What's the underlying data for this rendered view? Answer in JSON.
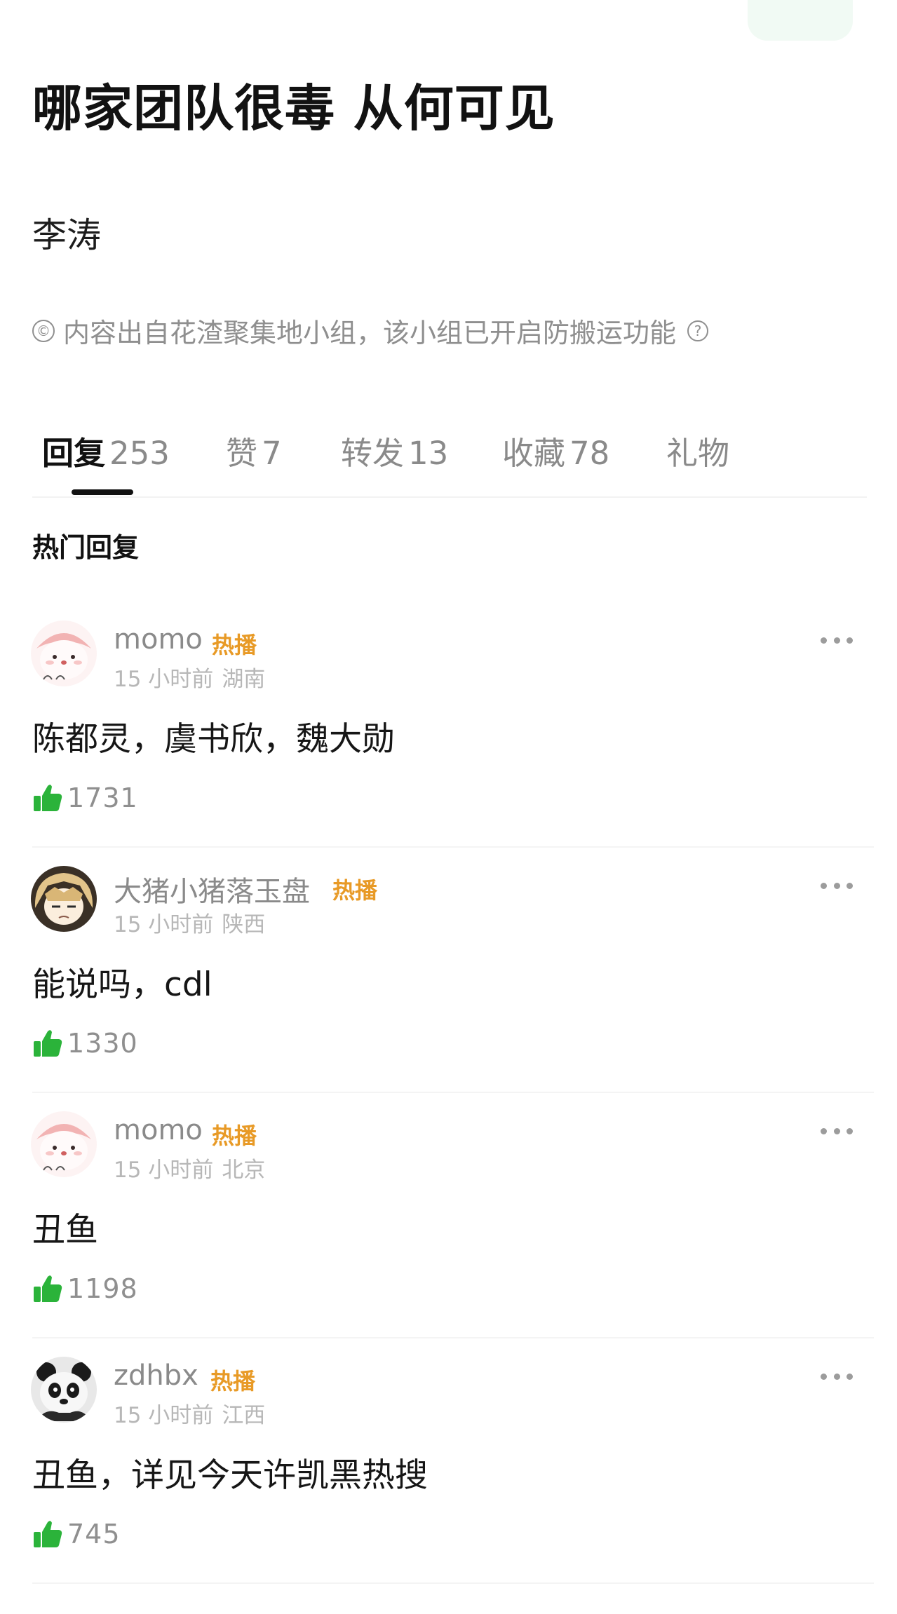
{
  "post": {
    "title": "哪家团队很毒 从何可见",
    "author": "李涛",
    "notice": "内容出自花渣聚集地小组，该小组已开启防搬运功能",
    "copyright_symbol": "©",
    "help_symbol": "?"
  },
  "tabs": [
    {
      "label": "回复",
      "count": "253",
      "active": true
    },
    {
      "label": "赞",
      "count": "7",
      "active": false
    },
    {
      "label": "转发",
      "count": "13",
      "active": false
    },
    {
      "label": "收藏",
      "count": "78",
      "active": false
    },
    {
      "label": "礼物",
      "count": "",
      "active": false
    }
  ],
  "section_title": "热门回复",
  "comments": [
    {
      "username": "momo",
      "badge": "热播",
      "time": "15 小时前",
      "location": "湖南",
      "text": "陈都灵，虞书欣，魏大勋",
      "likes": "1731",
      "avatar": "pink-cartoon-avatar"
    },
    {
      "username": "大猪小猪落玉盘",
      "badge": "热播",
      "time": "15 小时前",
      "location": "陕西",
      "text": "能说吗，cdl",
      "likes": "1330",
      "avatar": "anime-blonde-avatar"
    },
    {
      "username": "momo",
      "badge": "热播",
      "time": "15 小时前",
      "location": "北京",
      "text": "丑鱼",
      "likes": "1198",
      "avatar": "pink-cartoon-avatar"
    },
    {
      "username": "zdhbx",
      "badge": "热播",
      "time": "15 小时前",
      "location": "江西",
      "text": "丑鱼，详见今天许凯黑热搜",
      "likes": "745",
      "avatar": "panda-avatar"
    }
  ],
  "colors": {
    "like_green": "#2bb33a",
    "hot_badge": "#e89a26",
    "muted_text": "#8a8a8a"
  }
}
